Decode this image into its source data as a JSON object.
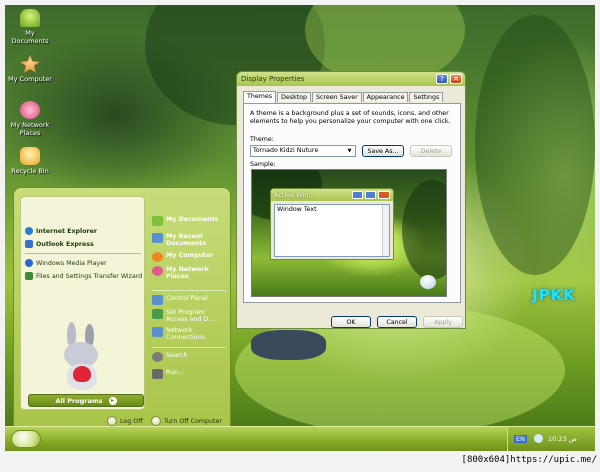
{
  "desktop": {
    "icons": [
      {
        "label": "My Documents",
        "icon": "my-documents-icon",
        "color": "#7fbf3a"
      },
      {
        "label": "My Computer",
        "icon": "my-computer-icon",
        "color": "#f08a1e"
      },
      {
        "label": "My Network Places",
        "icon": "network-places-icon",
        "color": "#e35a8a"
      },
      {
        "label": "Recycle Bin",
        "icon": "recycle-bin-icon",
        "color": "#f2b83a"
      }
    ],
    "watermark": "JPKK"
  },
  "start_menu": {
    "pinned": [
      {
        "label": "Internet Explorer",
        "icon": "internet-explorer-icon",
        "color": "#2a7fd8"
      },
      {
        "label": "Outlook Express",
        "icon": "outlook-express-icon",
        "color": "#3a6fc8"
      }
    ],
    "recent": [
      {
        "label": "Windows Media Player",
        "icon": "media-player-icon",
        "color": "#2a66cc"
      },
      {
        "label": "Files and Settings Transfer Wizard",
        "icon": "transfer-wizard-icon",
        "color": "#3a8a3a"
      }
    ],
    "all_programs": "All Programs",
    "right": [
      {
        "label": "My Documents",
        "icon": "my-documents-icon",
        "color": "#7fbf3a",
        "bold": true
      },
      {
        "label": "My Recent Documents",
        "icon": "recent-documents-icon",
        "color": "#5a8fd0",
        "bold": true
      },
      {
        "label": "My Computer",
        "icon": "my-computer-icon",
        "color": "#f08a1e",
        "bold": true
      },
      {
        "label": "My Network Places",
        "icon": "network-places-icon",
        "color": "#e35a8a",
        "bold": true
      },
      {
        "label": "Control Panel",
        "icon": "control-panel-icon",
        "color": "#5a8fd0",
        "bold": false
      },
      {
        "label": "Set Program Access and D...",
        "icon": "program-access-icon",
        "color": "#4a9a4a",
        "bold": false
      },
      {
        "label": "Network Connections",
        "icon": "network-connections-icon",
        "color": "#5a8fd0",
        "bold": false
      },
      {
        "label": "Search",
        "icon": "search-icon",
        "color": "#7a7a7a",
        "bold": false
      },
      {
        "label": "Run...",
        "icon": "run-icon",
        "color": "#6a6a6a",
        "bold": false
      }
    ],
    "log_off": "Log Off",
    "turn_off": "Turn Off Computer"
  },
  "dialog": {
    "title": "Display Properties",
    "tabs": [
      "Themes",
      "Desktop",
      "Screen Saver",
      "Appearance",
      "Settings"
    ],
    "active_tab": "Themes",
    "description": "A theme is a background plus a set of sounds, icons, and other elements to help you personalize your computer with one click.",
    "theme_label": "Theme:",
    "theme_value": "Tornado Kidzi Nuture",
    "save_as": "Save As...",
    "delete": "Delete",
    "sample_label": "Sample:",
    "sample_window_title": "Active Win...",
    "sample_window_text": "Window Text",
    "ok": "OK",
    "cancel": "Cancel",
    "apply": "Apply"
  },
  "taskbar": {
    "language": "EN",
    "clock": "10:23 ص"
  },
  "footer_credit": "[800x604]https://upic.me/",
  "colors": {
    "accent": "#9cc23d",
    "title_text": "#1e3a0a"
  }
}
